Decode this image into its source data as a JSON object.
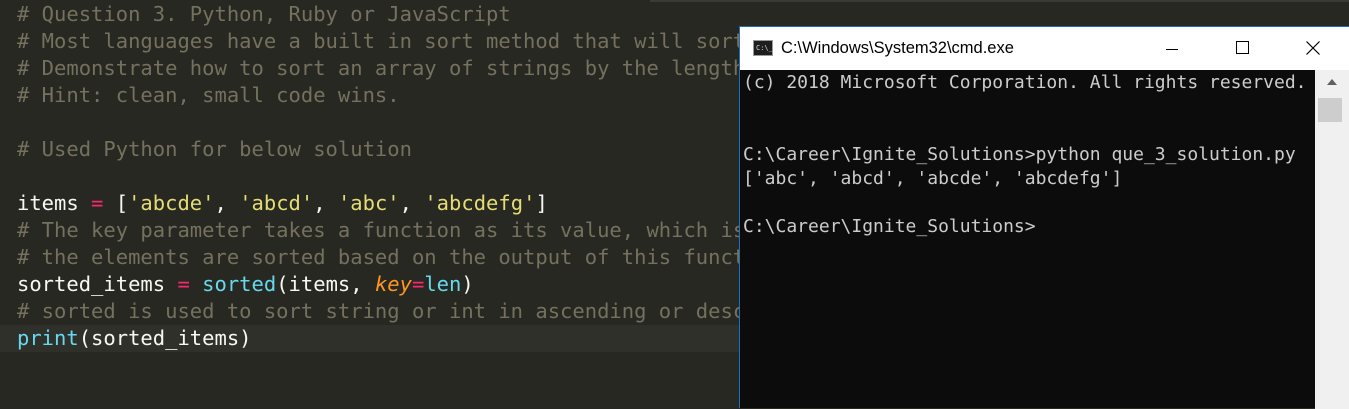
{
  "editor": {
    "lines": [
      [
        {
          "t": "# Question 3. Python, Ruby or JavaScript",
          "c": "comment"
        }
      ],
      [
        {
          "t": "# Most languages have a built in sort method that will sort",
          "c": "comment"
        }
      ],
      [
        {
          "t": "# Demonstrate how to sort an array of strings by the length",
          "c": "comment"
        }
      ],
      [
        {
          "t": "# Hint: clean, small code wins.",
          "c": "comment"
        }
      ],
      [],
      [
        {
          "t": "# Used Python for below solution",
          "c": "comment"
        }
      ],
      [],
      [
        {
          "t": "items",
          "c": "plain"
        },
        {
          "t": " = ",
          "c": "op"
        },
        {
          "t": "[",
          "c": "plain"
        },
        {
          "t": "'abcde'",
          "c": "str"
        },
        {
          "t": ", ",
          "c": "plain"
        },
        {
          "t": "'abcd'",
          "c": "str"
        },
        {
          "t": ", ",
          "c": "plain"
        },
        {
          "t": "'abc'",
          "c": "str"
        },
        {
          "t": ", ",
          "c": "plain"
        },
        {
          "t": "'abcdefg'",
          "c": "str"
        },
        {
          "t": "]",
          "c": "plain"
        }
      ],
      [
        {
          "t": "# The key parameter takes a function as its value, which is",
          "c": "comment"
        }
      ],
      [
        {
          "t": "# the elements are sorted based on the output of this funct",
          "c": "comment"
        }
      ],
      [
        {
          "t": "sorted_items",
          "c": "plain"
        },
        {
          "t": " = ",
          "c": "op"
        },
        {
          "t": "sorted",
          "c": "fn"
        },
        {
          "t": "(items, ",
          "c": "plain"
        },
        {
          "t": "key",
          "c": "kw"
        },
        {
          "t": "=",
          "c": "op"
        },
        {
          "t": "len",
          "c": "fn"
        },
        {
          "t": ")",
          "c": "plain"
        }
      ],
      [
        {
          "t": "# sorted is used to sort string or int in ascending or desc",
          "c": "comment"
        }
      ],
      [
        {
          "t": "print",
          "c": "fn"
        },
        {
          "t": "(sorted_items)",
          "c": "plain"
        }
      ]
    ]
  },
  "cmd": {
    "title": "C:\\Windows\\System32\\cmd.exe",
    "icon": "cmd-icon",
    "lines": [
      "(c) 2018 Microsoft Corporation. All rights reserved.",
      "",
      "",
      "C:\\Career\\Ignite_Solutions>python que_3_solution.py",
      "['abc', 'abcd', 'abcde', 'abcdefg']",
      "",
      "C:\\Career\\Ignite_Solutions>"
    ]
  },
  "colors": {
    "editor_bg": "#272822",
    "comment": "#75715e",
    "string": "#e6db74",
    "operator": "#f92672",
    "builtin": "#66d9ef",
    "keyword_arg": "#fd971f",
    "console_bg": "#0c0c0c",
    "console_text": "#cccccc"
  }
}
